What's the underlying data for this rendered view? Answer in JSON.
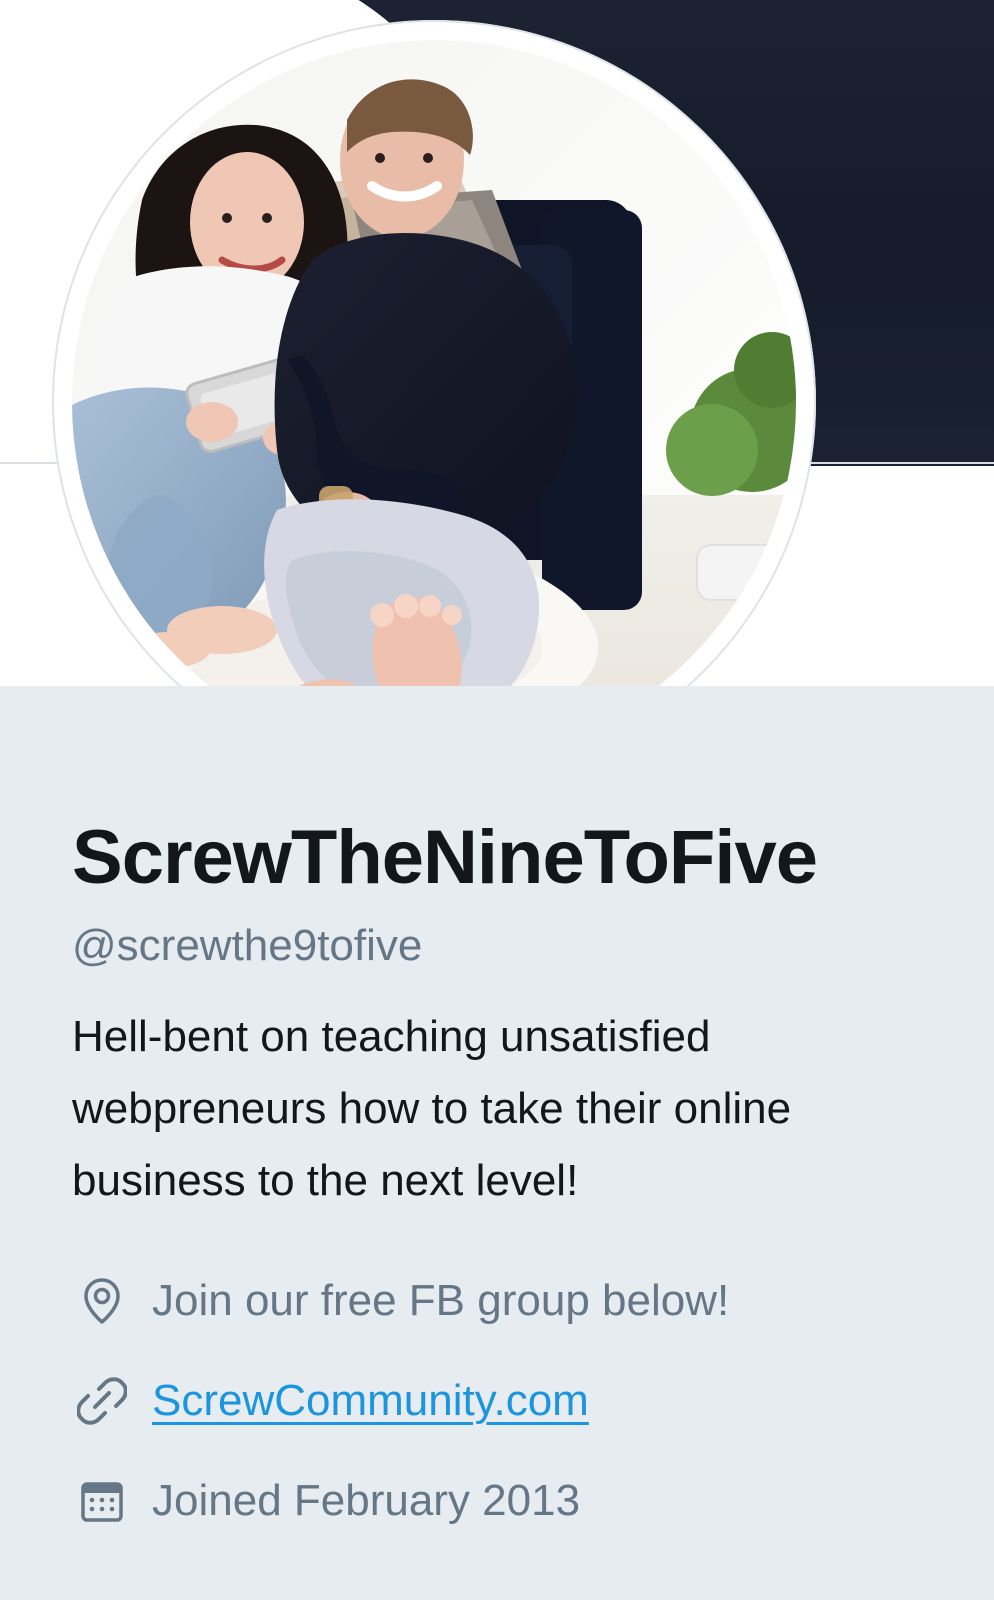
{
  "profile": {
    "display_name": "ScrewTheNineToFive",
    "handle": "@screwthe9tofive",
    "bio": "Hell-bent on teaching unsatisfied webpreneurs how to take their online business to the next level!",
    "location": "Join our free FB group below!",
    "url": "ScrewCommunity.com",
    "joined": "Joined February 2013"
  },
  "icons": {
    "location": "location-pin-icon",
    "url": "link-icon",
    "joined": "calendar-icon"
  },
  "colors": {
    "page_bg": "#e6ecf0",
    "name": "#14171a",
    "secondary": "#657786",
    "link": "#1b95e0"
  }
}
